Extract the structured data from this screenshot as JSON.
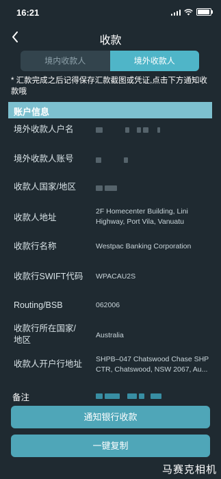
{
  "status": {
    "time": "16:21"
  },
  "nav": {
    "title": "收款"
  },
  "tabs": [
    {
      "label": "境内收款人"
    },
    {
      "label": "境外收款人"
    }
  ],
  "notice": "* 汇款完成之后记得保存汇款截图或凭证,点击下方通知收款哦",
  "section": {
    "title": "账户信息"
  },
  "rows": [
    {
      "label": "境外收款人户名",
      "value": ""
    },
    {
      "label": "境外收款人账号",
      "value": ""
    },
    {
      "label": "收款人国家/地区",
      "value": ""
    },
    {
      "label": "收款人地址",
      "value": "2F Homecenter Building, Lini Highway, Port Vila, Vanuatu"
    },
    {
      "label": "收款行名称",
      "value": "Westpac Banking Corporation"
    },
    {
      "label": "收款行SWIFT代码",
      "value": "WPACAU2S"
    },
    {
      "label": "Routing/BSB",
      "value": "062006"
    },
    {
      "label": "收款行所在国家/地区",
      "value": "Australia"
    },
    {
      "label": "收款人开户行地址",
      "value": "SHPB–047 Chatswood Chase SHP CTR, Chatswood, NSW 2067, Au..."
    }
  ],
  "remark": {
    "label": "备注"
  },
  "buttons": {
    "notify": "通知银行收款",
    "copy": "一键复制"
  },
  "watermark": "马赛克相机",
  "colors": {
    "background": "#1f2a31",
    "accent": "#4fb5c8",
    "section_header": "#7dc0cf",
    "button": "#4fa6b8"
  }
}
